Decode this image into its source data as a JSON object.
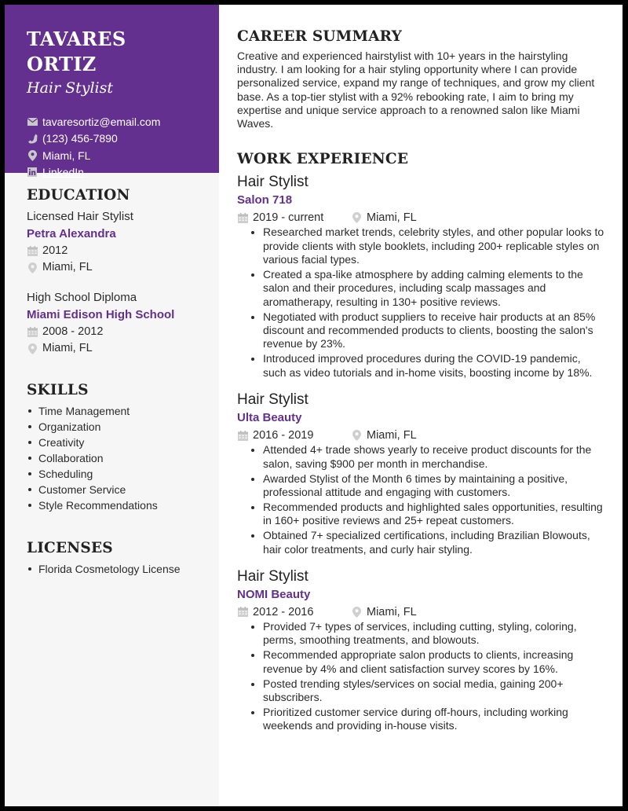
{
  "header": {
    "name": "TAVARES ORTIZ",
    "title": "Hair Stylist",
    "contacts": [
      {
        "icon": "envelope-icon",
        "text": "tavaresortiz@email.com"
      },
      {
        "icon": "phone-icon",
        "text": "(123) 456-7890"
      },
      {
        "icon": "map-pin-icon",
        "text": "Miami, FL"
      },
      {
        "icon": "linkedin-icon",
        "text": "LinkedIn"
      }
    ]
  },
  "colors": {
    "accent": "#63308f",
    "sidebar_bg": "#f6f6f6",
    "icon_gray": "#c8c8c8",
    "text": "#2b2b2b"
  },
  "education": {
    "title": "EDUCATION",
    "items": [
      {
        "degree": "Licensed Hair Stylist",
        "school": "Petra Alexandra",
        "dates": "2012",
        "location": "Miami, FL"
      },
      {
        "degree": "High School Diploma",
        "school": "Miami Edison High School",
        "dates": "2008 - 2012",
        "location": "Miami, FL"
      }
    ]
  },
  "skills": {
    "title": "SKILLS",
    "items": [
      "Time Management",
      "Organization",
      "Creativity",
      "Collaboration",
      "Scheduling",
      "Customer Service",
      "Style Recommendations"
    ]
  },
  "licenses": {
    "title": "LICENSES",
    "items": [
      "Florida Cosmetology License"
    ]
  },
  "summary": {
    "title": "CAREER SUMMARY",
    "text": "Creative and experienced hairstylist with 10+ years in the hairstyling industry. I am looking for a hair styling opportunity where I can provide personalized service, expand my range of techniques, and grow my client base. As a top-tier stylist with a 92% rebooking rate, I aim to bring my expertise and unique service approach to a renowned salon like Miami Waves."
  },
  "experience": {
    "title": "WORK EXPERIENCE",
    "jobs": [
      {
        "title": "Hair Stylist",
        "company": "Salon 718",
        "dates": "2019 - current",
        "location": "Miami, FL",
        "bullets": [
          "Researched market trends, celebrity styles, and other popular looks to provide clients with style booklets, including 200+ replicable styles on various facial types.",
          "Created a spa-like atmosphere by adding calming elements to the salon and their procedures, including scalp massages and aromatherapy, resulting in 130+ positive reviews.",
          "Negotiated with product suppliers to receive hair products at an 85% discount and recommended products to clients, boosting the salon's revenue by 23%.",
          "Introduced improved procedures during the COVID-19 pandemic, such as video tutorials and in-home visits, boosting income by 18%."
        ]
      },
      {
        "title": "Hair Stylist",
        "company": "Ulta Beauty",
        "dates": "2016 - 2019",
        "location": "Miami, FL",
        "bullets": [
          "Attended 4+ trade shows yearly to receive product discounts for the salon, saving $900 per month in merchandise.",
          "Awarded Stylist of the Month 6 times by maintaining a positive, professional attitude and engaging with customers.",
          "Recommended products and highlighted sales opportunities, resulting in 160+ positive reviews and 25+ repeat customers.",
          "Obtained 7+ specialized certifications, including Brazilian Blowouts, hair color treatments, and curly hair styling."
        ]
      },
      {
        "title": "Hair Stylist",
        "company": "NOMI Beauty",
        "dates": "2012 - 2016",
        "location": "Miami, FL",
        "bullets": [
          "Provided 7+ types of services, including cutting, styling, coloring, perms, smoothing treatments, and blowouts.",
          "Recommended appropriate salon products to clients, increasing revenue by 4% and client satisfaction survey scores by 16%.",
          "Posted trending styles/services on social media, gaining 200+ subscribers.",
          "Prioritized customer service during off-hours, including working weekends and providing in-house visits."
        ]
      }
    ]
  }
}
